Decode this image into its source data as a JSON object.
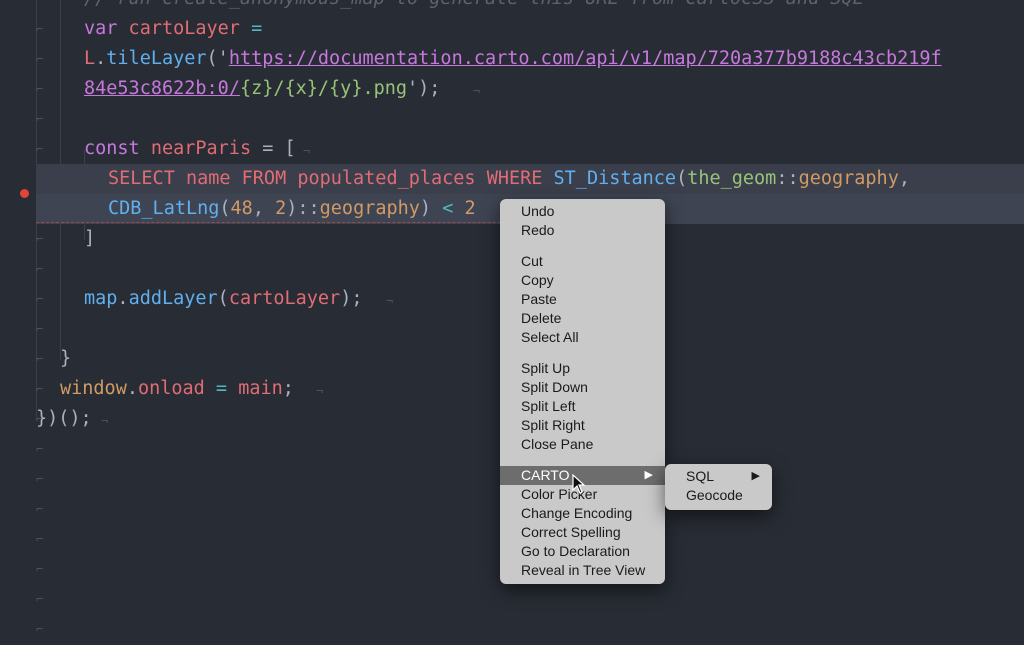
{
  "editor": {
    "lines": [
      {
        "tokens": [
          {
            "t": "// run create_anonymous_map to generate this URL from CartoCSS and SQL",
            "c": "cm"
          }
        ]
      },
      {
        "tokens": [
          {
            "t": "var",
            "c": "kw"
          },
          {
            "t": " cartoLayer ",
            "c": "var"
          },
          {
            "t": "=",
            "c": "op"
          }
        ]
      },
      {
        "tokens": [
          {
            "t": "L",
            "c": "var"
          },
          {
            "t": ".",
            "c": "pl"
          },
          {
            "t": "tileLayer",
            "c": "fn"
          },
          {
            "t": "('",
            "c": "pl"
          },
          {
            "t": "https://documentation.carto.com/api/v1/map/720a377b9188c43cb219f",
            "c": "url"
          }
        ]
      },
      {
        "tokens": [
          {
            "t": "84e53c8622b:0/",
            "c": "url"
          },
          {
            "t": "{z}/{x}/{y}.png",
            "c": "str"
          },
          {
            "t": "');",
            "c": "pl"
          }
        ]
      },
      {
        "tokens": []
      },
      {
        "tokens": [
          {
            "t": "const",
            "c": "kw"
          },
          {
            "t": " nearParis ",
            "c": "var"
          },
          {
            "t": "= [",
            "c": "pl"
          }
        ]
      },
      {
        "tokens": [
          {
            "t": "SELECT name FROM populated_places WHERE ",
            "c": "sqlk"
          },
          {
            "t": "ST_Distance",
            "c": "fn"
          },
          {
            "t": "(",
            "c": "pl"
          },
          {
            "t": "the_geom",
            "c": "str"
          },
          {
            "t": "::",
            "c": "pl"
          },
          {
            "t": "geography",
            "c": "geo"
          },
          {
            "t": ",",
            "c": "pl"
          }
        ]
      },
      {
        "tokens": [
          {
            "t": "CDB_LatLng",
            "c": "fn"
          },
          {
            "t": "(",
            "c": "pl"
          },
          {
            "t": "48",
            "c": "num"
          },
          {
            "t": ", ",
            "c": "pl"
          },
          {
            "t": "2",
            "c": "num"
          },
          {
            "t": ")::",
            "c": "pl"
          },
          {
            "t": "geography",
            "c": "geo"
          },
          {
            "t": ") ",
            "c": "pl"
          },
          {
            "t": "<",
            "c": "op"
          },
          {
            "t": " 2",
            "c": "num"
          }
        ]
      },
      {
        "tokens": [
          {
            "t": "]",
            "c": "pl"
          }
        ]
      },
      {
        "tokens": []
      },
      {
        "tokens": [
          {
            "t": "map",
            "c": "fn"
          },
          {
            "t": ".",
            "c": "pl"
          },
          {
            "t": "addLayer",
            "c": "fn"
          },
          {
            "t": "(",
            "c": "pl"
          },
          {
            "t": "cartoLayer",
            "c": "var"
          },
          {
            "t": ");",
            "c": "pl"
          }
        ]
      },
      {
        "tokens": []
      },
      {
        "tokens": [
          {
            "t": "}",
            "c": "pl"
          }
        ]
      },
      {
        "tokens": [
          {
            "t": "window",
            "c": "num"
          },
          {
            "t": ".",
            "c": "pl"
          },
          {
            "t": "onload",
            "c": "var"
          },
          {
            "t": " = ",
            "c": "op"
          },
          {
            "t": "main",
            "c": "var"
          },
          {
            "t": ";",
            "c": "pl"
          }
        ]
      },
      {
        "tokens": [
          {
            "t": "})();",
            "c": "pl"
          }
        ]
      }
    ],
    "gutter_glyph": "⌐",
    "eol_glyph": "¬"
  },
  "context_menu": {
    "groups": [
      [
        "Undo",
        "Redo"
      ],
      [
        "Cut",
        "Copy",
        "Paste",
        "Delete",
        "Select All"
      ],
      [
        "Split Up",
        "Split Down",
        "Split Left",
        "Split Right",
        "Close Pane"
      ],
      [
        "CARTO",
        "Color Picker",
        "Change Encoding",
        "Correct Spelling",
        "Go to Declaration",
        "Reveal in Tree View"
      ]
    ],
    "active_item": "CARTO",
    "submenu_arrow": "▶"
  },
  "submenu": {
    "items": [
      {
        "label": "SQL",
        "has_submenu": true
      },
      {
        "label": "Geocode",
        "has_submenu": false
      }
    ]
  },
  "colors": {
    "editor_bg": "#282c34",
    "menu_bg": "#c9c9c9",
    "menu_active": "#6d6d6d",
    "error": "#e0453a"
  }
}
